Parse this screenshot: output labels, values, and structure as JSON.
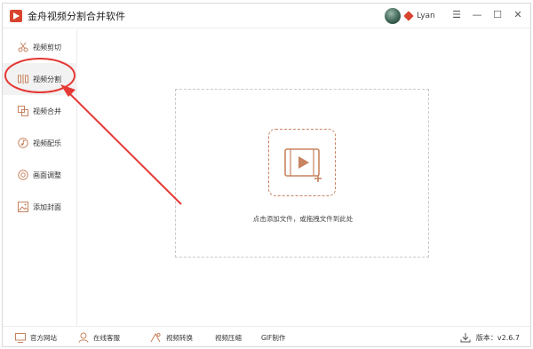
{
  "app": {
    "title": "金舟视频分割合并软件"
  },
  "user": {
    "name": "Lyan"
  },
  "window_controls": {
    "menu": "☰",
    "minimize": "—",
    "maximize": "☐",
    "close": "✕"
  },
  "sidebar": {
    "items": [
      {
        "label": "视频剪切",
        "icon": "scissors-icon"
      },
      {
        "label": "视频分割",
        "icon": "split-icon",
        "active": true
      },
      {
        "label": "视频合并",
        "icon": "merge-icon"
      },
      {
        "label": "视频配乐",
        "icon": "music-icon"
      },
      {
        "label": "画面调整",
        "icon": "adjust-icon"
      },
      {
        "label": "添加封面",
        "icon": "cover-icon"
      }
    ]
  },
  "main": {
    "drop_text": "点击添加文件，或拖拽文件到此处"
  },
  "footer": {
    "website": "官方网站",
    "support": "在线客服",
    "convert": "视频转换",
    "compress": "视频压缩",
    "gif": "GIF制作",
    "version_label": "版本：",
    "version": "v2.6.7"
  },
  "colors": {
    "accent": "#d9442e",
    "icon": "#c8835f",
    "annotation": "#e53935"
  }
}
